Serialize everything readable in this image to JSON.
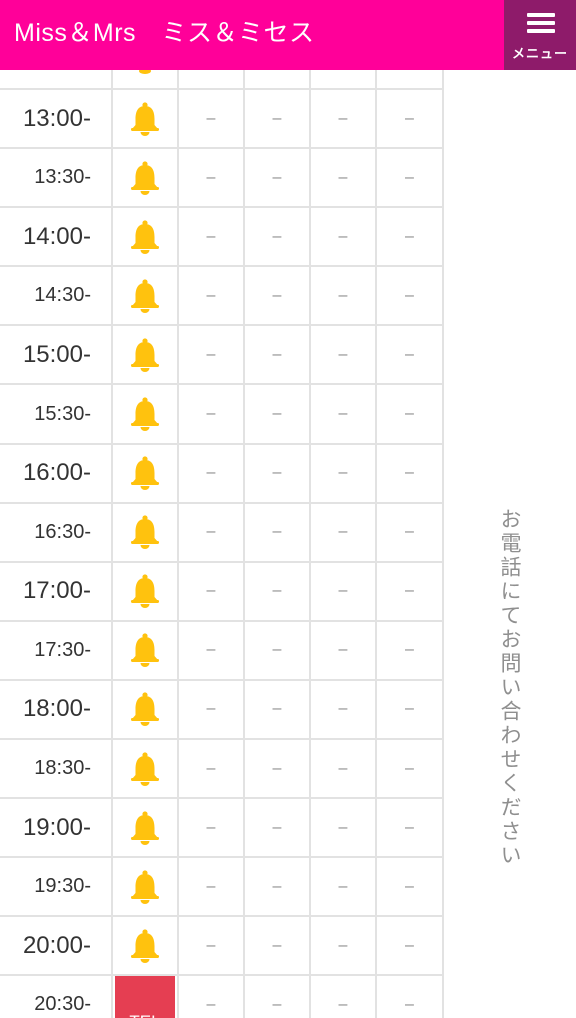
{
  "header": {
    "title": "Miss＆Mrs　ミス＆ミセス",
    "menu_label": "メニュー"
  },
  "side_note": "お電話にてお問い合わせください",
  "dash": "–",
  "tel_label": "TEL",
  "rows": [
    {
      "time": "13:00-",
      "status": "bell"
    },
    {
      "time": "13:30-",
      "status": "bell"
    },
    {
      "time": "14:00-",
      "status": "bell"
    },
    {
      "time": "14:30-",
      "status": "bell"
    },
    {
      "time": "15:00-",
      "status": "bell"
    },
    {
      "time": "15:30-",
      "status": "bell"
    },
    {
      "time": "16:00-",
      "status": "bell"
    },
    {
      "time": "16:30-",
      "status": "bell"
    },
    {
      "time": "17:00-",
      "status": "bell"
    },
    {
      "time": "17:30-",
      "status": "bell"
    },
    {
      "time": "18:00-",
      "status": "bell"
    },
    {
      "time": "18:30-",
      "status": "bell"
    },
    {
      "time": "19:00-",
      "status": "bell"
    },
    {
      "time": "19:30-",
      "status": "bell"
    },
    {
      "time": "20:00-",
      "status": "bell"
    },
    {
      "time": "20:30-",
      "status": "tel"
    }
  ],
  "colors": {
    "header": "#ff0099",
    "menu": "#8e1b6a",
    "bell": "#ffc20e",
    "tel": "#e53e52"
  }
}
